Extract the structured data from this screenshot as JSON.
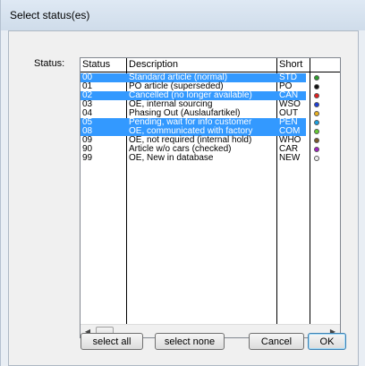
{
  "window": {
    "title": "Select status(es)"
  },
  "status_label": "Status:",
  "columns": {
    "status": "Status",
    "description": "Description",
    "short": "Short"
  },
  "rows": [
    {
      "status": "00",
      "description": "Standard article (normal)",
      "short": "STD",
      "selected": true,
      "color": "#2d9e2d"
    },
    {
      "status": "01",
      "description": "PO article (superseded)",
      "short": "PO",
      "selected": false,
      "color": "#111111"
    },
    {
      "status": "02",
      "description": "Cancelled (no longer available)",
      "short": "CAN",
      "selected": true,
      "color": "#e02020"
    },
    {
      "status": "03",
      "description": "OE, internal sourcing",
      "short": "WSO",
      "selected": false,
      "color": "#1e3fd6"
    },
    {
      "status": "04",
      "description": "Phasing Out (Auslaufartikel)",
      "short": "OUT",
      "selected": false,
      "color": "#e8b020"
    },
    {
      "status": "05",
      "description": "Pending, wait for info customer",
      "short": "PEN",
      "selected": true,
      "color": "#1aa0e0"
    },
    {
      "status": "08",
      "description": "OE, communicated with factory",
      "short": "COM",
      "selected": true,
      "color": "#66cc33"
    },
    {
      "status": "09",
      "description": "OE, not required (internal hold)",
      "short": "WHO",
      "selected": false,
      "color": "#7a5a2a"
    },
    {
      "status": "90",
      "description": "Article w/o cars (checked)",
      "short": "CAR",
      "selected": false,
      "color": "#a020c0"
    },
    {
      "status": "99",
      "description": "OE, New in database",
      "short": "NEW",
      "selected": false,
      "color": "#f0f0f0"
    }
  ],
  "buttons": {
    "select_all": "select all",
    "select_none": "select none",
    "cancel": "Cancel",
    "ok": "OK"
  },
  "scroll": {
    "left": "◀",
    "right": "▶"
  }
}
